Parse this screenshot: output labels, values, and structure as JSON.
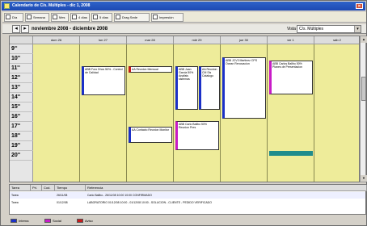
{
  "window": {
    "title": "Calendario de C/s. Múltiples - dic 1, 2008"
  },
  "toolbar": {
    "buttons": [
      "Día",
      "Semana",
      "Mes",
      "4 días",
      "5 días",
      "Drag Sede",
      "Impresión"
    ]
  },
  "nav": {
    "range_label": "noviembre 2008 - diciembre 2008",
    "prev_label": "◂",
    "next_label": "▸",
    "view_label": "Vista",
    "view_value": "C/s. Múltiples"
  },
  "calendar": {
    "days": [
      "dom 26",
      "lun 27",
      "mar 28",
      "mié 29",
      "jue 30",
      "vie 1",
      "sáb 2"
    ],
    "hours": [
      "9",
      "10",
      "11",
      "12",
      "13",
      "14",
      "15",
      "16",
      "17",
      "18",
      "19",
      "20"
    ],
    "minute_mark": "00",
    "appointments": [
      {
        "text": "ABB Foro Dhcs 50% - Control de Calidad",
        "color": "#1b30c8"
      },
      {
        "text": "AA Reunion Mensual",
        "color": "#c81b1b"
      },
      {
        "text": "ABB Juan Garcia 50% Analisis sistemas",
        "color": "#1b30c8"
      },
      {
        "text": "AA Reunion CM Sis Catalogo",
        "color": "#1b30c8"
      },
      {
        "text": "ABB JCV3 Martinez CPS Ocean Renovacion",
        "color": "#1b30c8"
      },
      {
        "text": "ABB Carlos Ballbo 50% Planes de Presentacion",
        "color": "#c81bc8"
      },
      {
        "text": "AA Contacto Reunion Monitor",
        "color": "#1b30c8"
      },
      {
        "text": "ABB Carlo Ballbo 50% Reunion Pres",
        "color": "#c81bc8"
      }
    ]
  },
  "table": {
    "headers": [
      "Tarea",
      "Pri.",
      "Cod.",
      "Tiempo",
      "Referencia"
    ],
    "rows": [
      [
        "Tarea",
        "",
        "",
        "26/11/08",
        "Carlo Ballbo - 26/11/08 10:00 10:00 CONFIRMADO"
      ],
      [
        "Tarea",
        "",
        "",
        "01/12/08",
        "LABORATORIO 01/12/08 10:00 - 01/12/08 10:00 - SOLUCION - CLIENTE - PEDIDO VERIFICADO"
      ]
    ]
  },
  "legend": [
    {
      "label": "Interna",
      "color": "#1b30c8"
    },
    {
      "label": "Social",
      "color": "#c81bc8"
    },
    {
      "label": "Aviso",
      "color": "#c81b1b"
    }
  ]
}
